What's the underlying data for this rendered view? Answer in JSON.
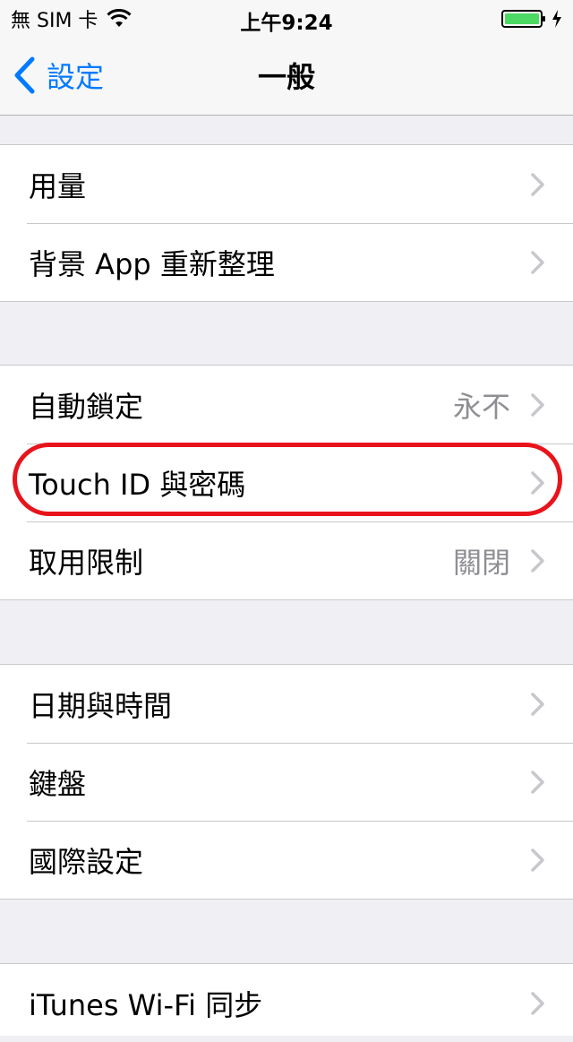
{
  "status": {
    "carrier": "無 SIM 卡",
    "time": "上午9:24",
    "battery_color": "#4cd964"
  },
  "nav": {
    "back_label": "設定",
    "title": "一般",
    "accent": "#007aff"
  },
  "groups": [
    {
      "rows": [
        {
          "label": "用量",
          "value": ""
        },
        {
          "label": "背景 App 重新整理",
          "value": ""
        }
      ]
    },
    {
      "rows": [
        {
          "label": "自動鎖定",
          "value": "永不"
        },
        {
          "label": "Touch ID 與密碼",
          "value": ""
        },
        {
          "label": "取用限制",
          "value": "關閉"
        }
      ]
    },
    {
      "rows": [
        {
          "label": "日期與時間",
          "value": ""
        },
        {
          "label": "鍵盤",
          "value": ""
        },
        {
          "label": "國際設定",
          "value": ""
        }
      ]
    },
    {
      "rows": [
        {
          "label": "iTunes Wi-Fi 同步",
          "value": ""
        }
      ]
    }
  ],
  "annotation_color": "#e8141b"
}
